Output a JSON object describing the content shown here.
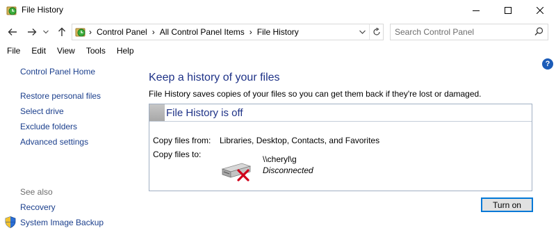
{
  "window": {
    "title": "File History",
    "controls": [
      "minimize-icon",
      "maximize-icon",
      "close-icon"
    ]
  },
  "address_bar": {
    "breadcrumbs": [
      "Control Panel",
      "All Control Panel Items",
      "File History"
    ],
    "search_placeholder": "Search Control Panel"
  },
  "menu": {
    "items": [
      "File",
      "Edit",
      "View",
      "Tools",
      "Help"
    ]
  },
  "sidebar": {
    "home": "Control Panel Home",
    "links": [
      "Restore personal files",
      "Select drive",
      "Exclude folders",
      "Advanced settings"
    ],
    "see_also_label": "See also",
    "see_also": [
      "Recovery",
      "System Image Backup"
    ]
  },
  "main": {
    "heading": "Keep a history of your files",
    "description": "File History saves copies of your files so you can get them back if they're lost or damaged.",
    "status": {
      "title": "File History is off",
      "copy_from_label": "Copy files from:",
      "copy_from_value": "Libraries, Desktop, Contacts, and Favorites",
      "copy_to_label": "Copy files to:",
      "drive_path": "\\\\cheryl\\g",
      "drive_status": "Disconnected"
    },
    "turn_on_label": "Turn on"
  },
  "colors": {
    "link": "#1a3e8c",
    "heading": "#1e3287",
    "button_border": "#0078d7",
    "error_x": "#d0021b"
  }
}
